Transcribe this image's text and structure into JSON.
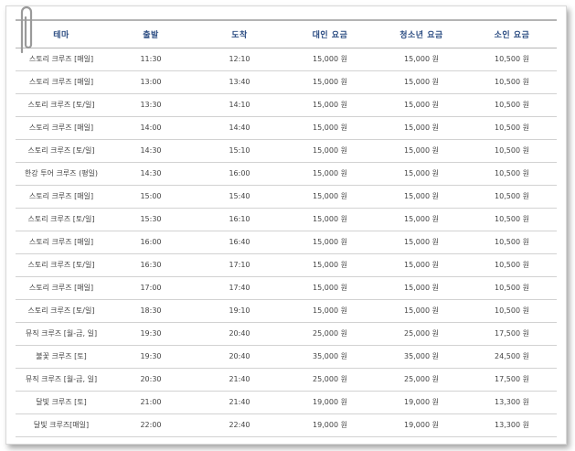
{
  "table": {
    "headers": [
      "테마",
      "출발",
      "도착",
      "대인 요금",
      "청소년 요금",
      "소인 요금"
    ],
    "rows": [
      [
        "스토리 크루즈 [매일]",
        "11:30",
        "12:10",
        "15,000 원",
        "15,000 원",
        "10,500 원"
      ],
      [
        "스토리 크루즈 [매일]",
        "13:00",
        "13:40",
        "15,000 원",
        "15,000 원",
        "10,500 원"
      ],
      [
        "스토리 크루즈 [토/일]",
        "13:30",
        "14:10",
        "15,000 원",
        "15,000 원",
        "10,500 원"
      ],
      [
        "스토리 크루즈 [매일]",
        "14:00",
        "14:40",
        "15,000 원",
        "15,000 원",
        "10,500 원"
      ],
      [
        "스토리 크루즈 [토/일]",
        "14:30",
        "15:10",
        "15,000 원",
        "15,000 원",
        "10,500 원"
      ],
      [
        "한강 투어 크루즈 (평일)",
        "14:30",
        "16:00",
        "15,000 원",
        "15,000 원",
        "10,500 원"
      ],
      [
        "스토리 크루즈 [매일]",
        "15:00",
        "15:40",
        "15,000 원",
        "15,000 원",
        "10,500 원"
      ],
      [
        "스토리 크루즈 [토/일]",
        "15:30",
        "16:10",
        "15,000 원",
        "15,000 원",
        "10,500 원"
      ],
      [
        "스토리 크루즈 [매일]",
        "16:00",
        "16:40",
        "15,000 원",
        "15,000 원",
        "10,500 원"
      ],
      [
        "스토리 크루즈 [토/일]",
        "16:30",
        "17:10",
        "15,000 원",
        "15,000 원",
        "10,500 원"
      ],
      [
        "스토리 크루즈 [매일]",
        "17:00",
        "17:40",
        "15,000 원",
        "15,000 원",
        "10,500 원"
      ],
      [
        "스토리 크루즈 [토/일]",
        "18:30",
        "19:10",
        "15,000 원",
        "15,000 원",
        "10,500 원"
      ],
      [
        "뮤직 크루즈 [월-금, 일]",
        "19:30",
        "20:40",
        "25,000 원",
        "25,000 원",
        "17,500 원"
      ],
      [
        "불꽃 크루즈 [토]",
        "19:30",
        "20:40",
        "35,000 원",
        "35,000 원",
        "24,500 원"
      ],
      [
        "뮤직 크루즈 [월-금, 일]",
        "20:30",
        "21:40",
        "25,000 원",
        "25,000 원",
        "17,500 원"
      ],
      [
        "달빛 크루즈 [토]",
        "21:00",
        "21:40",
        "19,000 원",
        "19,000 원",
        "13,300 원"
      ],
      [
        "달빛 크루즈[매일]",
        "22:00",
        "22:40",
        "19,000 원",
        "19,000 원",
        "13,300 원"
      ]
    ]
  },
  "colors": {
    "header_text": "#2b4c82",
    "body_text": "#444444",
    "row_divider": "#d2d2d2"
  },
  "icons": {
    "clip": "paperclip-icon"
  }
}
